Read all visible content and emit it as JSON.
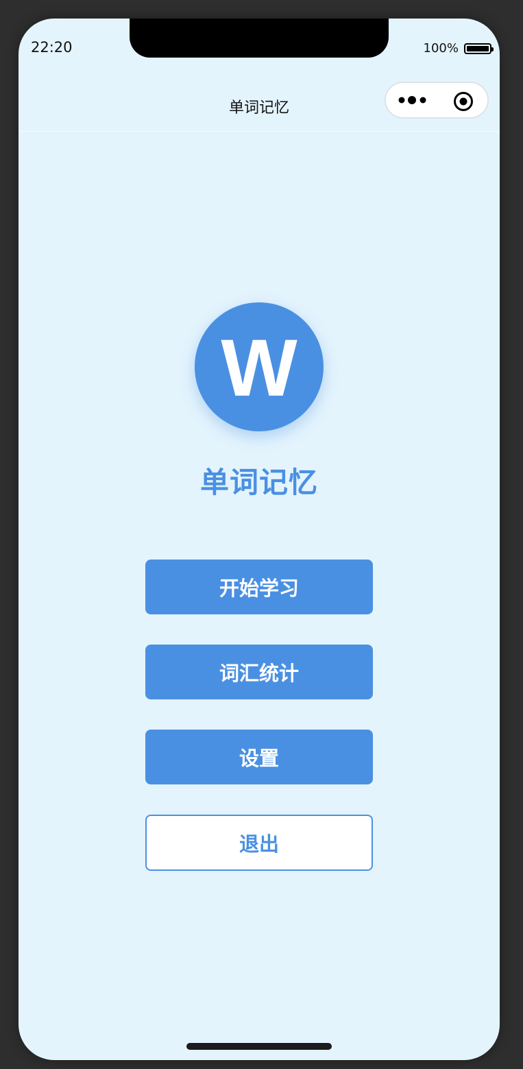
{
  "status_bar": {
    "time": "22:20",
    "battery_percent": "100%"
  },
  "nav": {
    "title": "单词记忆"
  },
  "logo": {
    "letter": "W"
  },
  "app_name": "单词记忆",
  "menu": {
    "start_label": "开始学习",
    "stats_label": "词汇统计",
    "settings_label": "设置",
    "exit_label": "退出"
  },
  "colors": {
    "accent": "#4a90e2",
    "background": "#e4f4fd"
  }
}
